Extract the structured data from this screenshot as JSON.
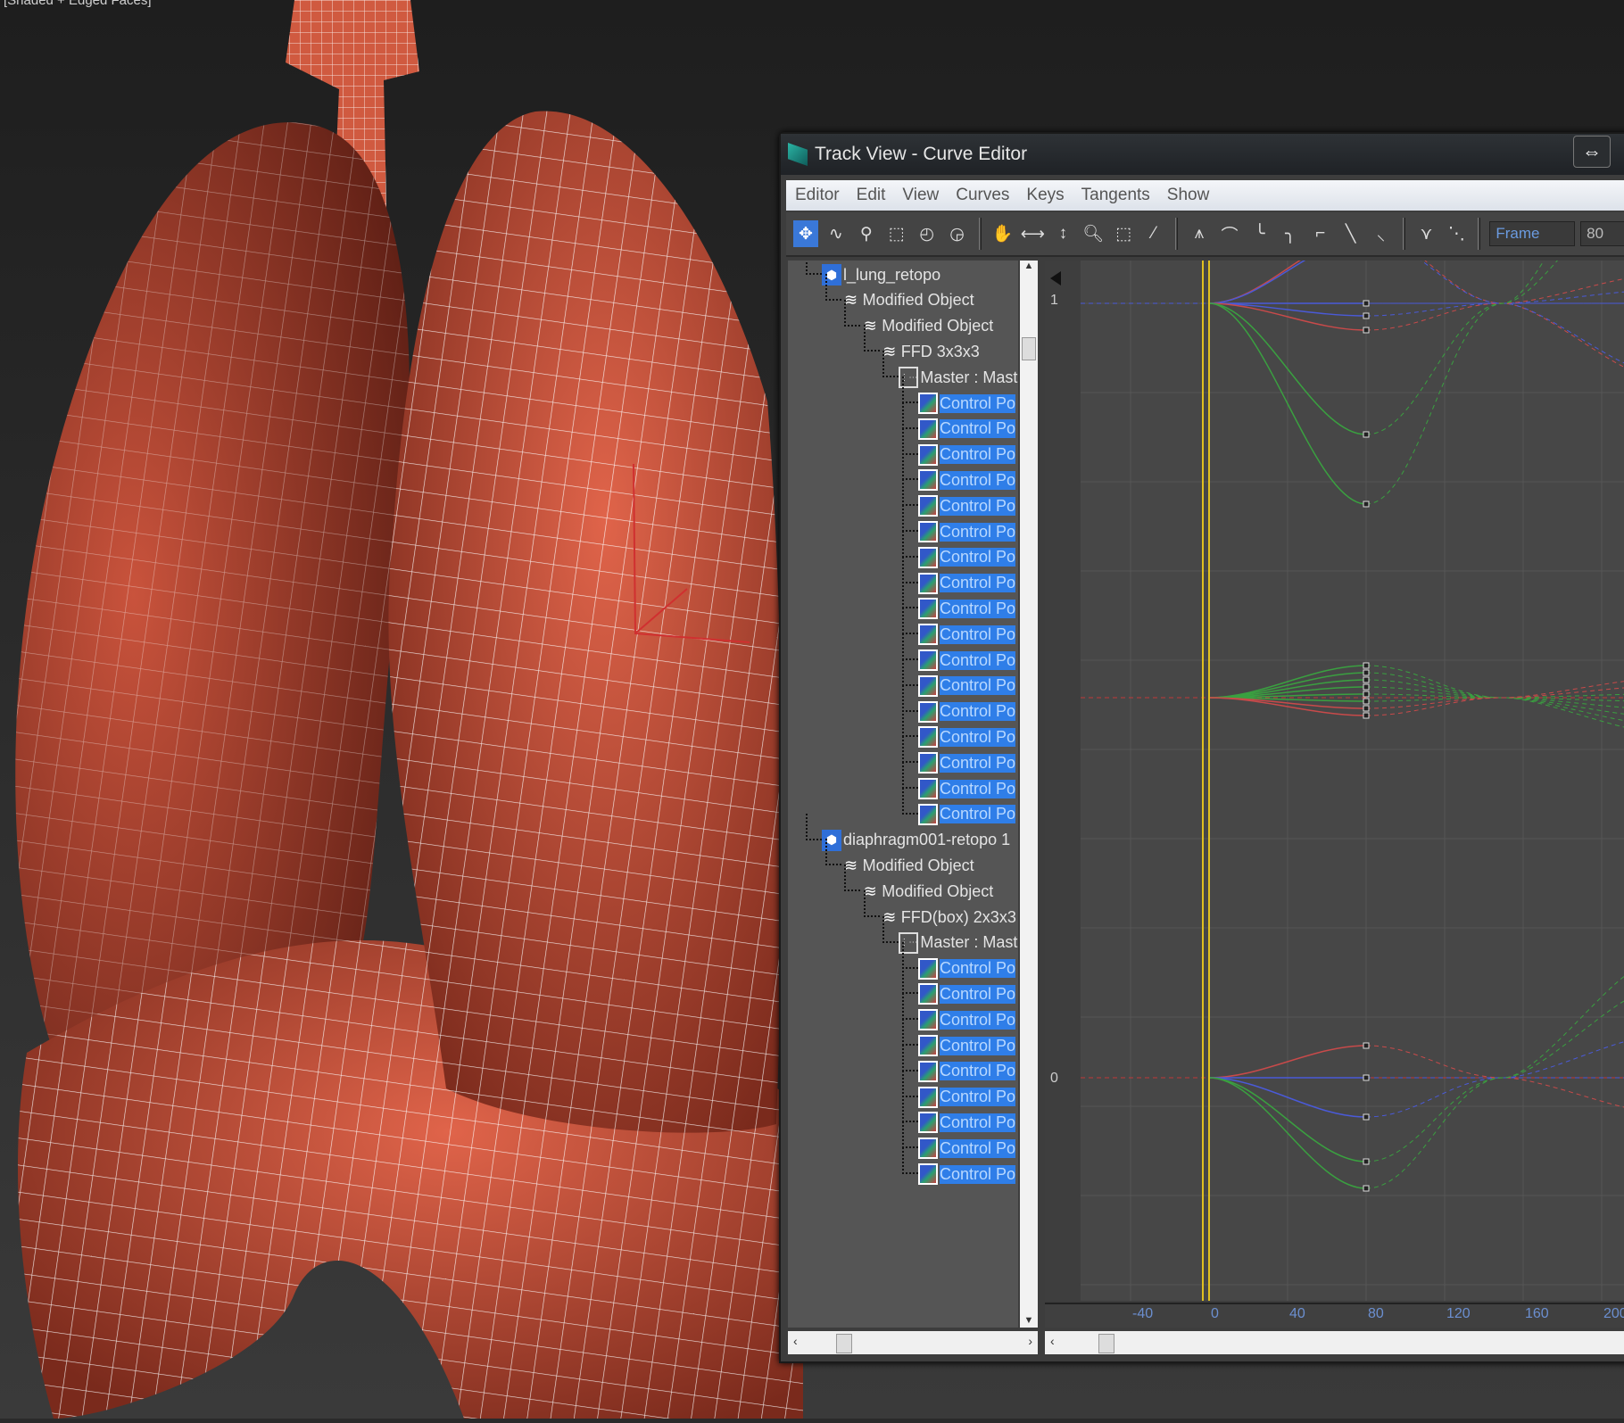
{
  "viewport": {
    "label": "[Shaded + Edged Faces]"
  },
  "window": {
    "title": "Track View - Curve Editor",
    "resize_icon": "⇔"
  },
  "menu": [
    "Editor",
    "Edit",
    "View",
    "Curves",
    "Keys",
    "Tangents",
    "Show"
  ],
  "toolbar": {
    "frame_label": "Frame",
    "frame_value": "80"
  },
  "tree": [
    {
      "label": "l_lung_retopo",
      "level": 0,
      "type": "obj"
    },
    {
      "label": "Modified Object",
      "level": 1,
      "type": "mod"
    },
    {
      "label": "Modified Object",
      "level": 2,
      "type": "mod"
    },
    {
      "label": "FFD 3x3x3",
      "level": 3,
      "type": "mod"
    },
    {
      "label": "Master : Master",
      "level": 4,
      "type": "master"
    },
    {
      "label": "Control Po",
      "level": 5,
      "type": "cp"
    },
    {
      "label": "Control Po",
      "level": 5,
      "type": "cp"
    },
    {
      "label": "Control Po",
      "level": 5,
      "type": "cp"
    },
    {
      "label": "Control Po",
      "level": 5,
      "type": "cp"
    },
    {
      "label": "Control Po",
      "level": 5,
      "type": "cp"
    },
    {
      "label": "Control Po",
      "level": 5,
      "type": "cp"
    },
    {
      "label": "Control Po",
      "level": 5,
      "type": "cp"
    },
    {
      "label": "Control Po",
      "level": 5,
      "type": "cp"
    },
    {
      "label": "Control Po",
      "level": 5,
      "type": "cp"
    },
    {
      "label": "Control Po",
      "level": 5,
      "type": "cp"
    },
    {
      "label": "Control Po",
      "level": 5,
      "type": "cp"
    },
    {
      "label": "Control Po",
      "level": 5,
      "type": "cp"
    },
    {
      "label": "Control Po",
      "level": 5,
      "type": "cp"
    },
    {
      "label": "Control Po",
      "level": 5,
      "type": "cp"
    },
    {
      "label": "Control Po",
      "level": 5,
      "type": "cp"
    },
    {
      "label": "Control Po",
      "level": 5,
      "type": "cp"
    },
    {
      "label": "Control Po",
      "level": 5,
      "type": "cp"
    },
    {
      "label": "diaphragm001-retopo 1",
      "level": 0,
      "type": "obj"
    },
    {
      "label": "Modified Object",
      "level": 1,
      "type": "mod"
    },
    {
      "label": "Modified Object",
      "level": 2,
      "type": "mod"
    },
    {
      "label": "FFD(box) 2x3x3",
      "level": 3,
      "type": "mod"
    },
    {
      "label": "Master : Master",
      "level": 4,
      "type": "master"
    },
    {
      "label": "Control Po",
      "level": 5,
      "type": "cp"
    },
    {
      "label": "Control Po",
      "level": 5,
      "type": "cp"
    },
    {
      "label": "Control Po",
      "level": 5,
      "type": "cp"
    },
    {
      "label": "Control Po",
      "level": 5,
      "type": "cp"
    },
    {
      "label": "Control Po",
      "level": 5,
      "type": "cp"
    },
    {
      "label": "Control Po",
      "level": 5,
      "type": "cp"
    },
    {
      "label": "Control Po",
      "level": 5,
      "type": "cp"
    },
    {
      "label": "Control Po",
      "level": 5,
      "type": "cp"
    },
    {
      "label": "Control Po",
      "level": 5,
      "type": "cp"
    }
  ],
  "graph": {
    "value_labels": {
      "one": "1",
      "zero": "0"
    },
    "ruler": [
      "-40",
      "0",
      "40",
      "80",
      "120",
      "160",
      "200"
    ],
    "current_frame": 0,
    "key_frame": 80
  }
}
